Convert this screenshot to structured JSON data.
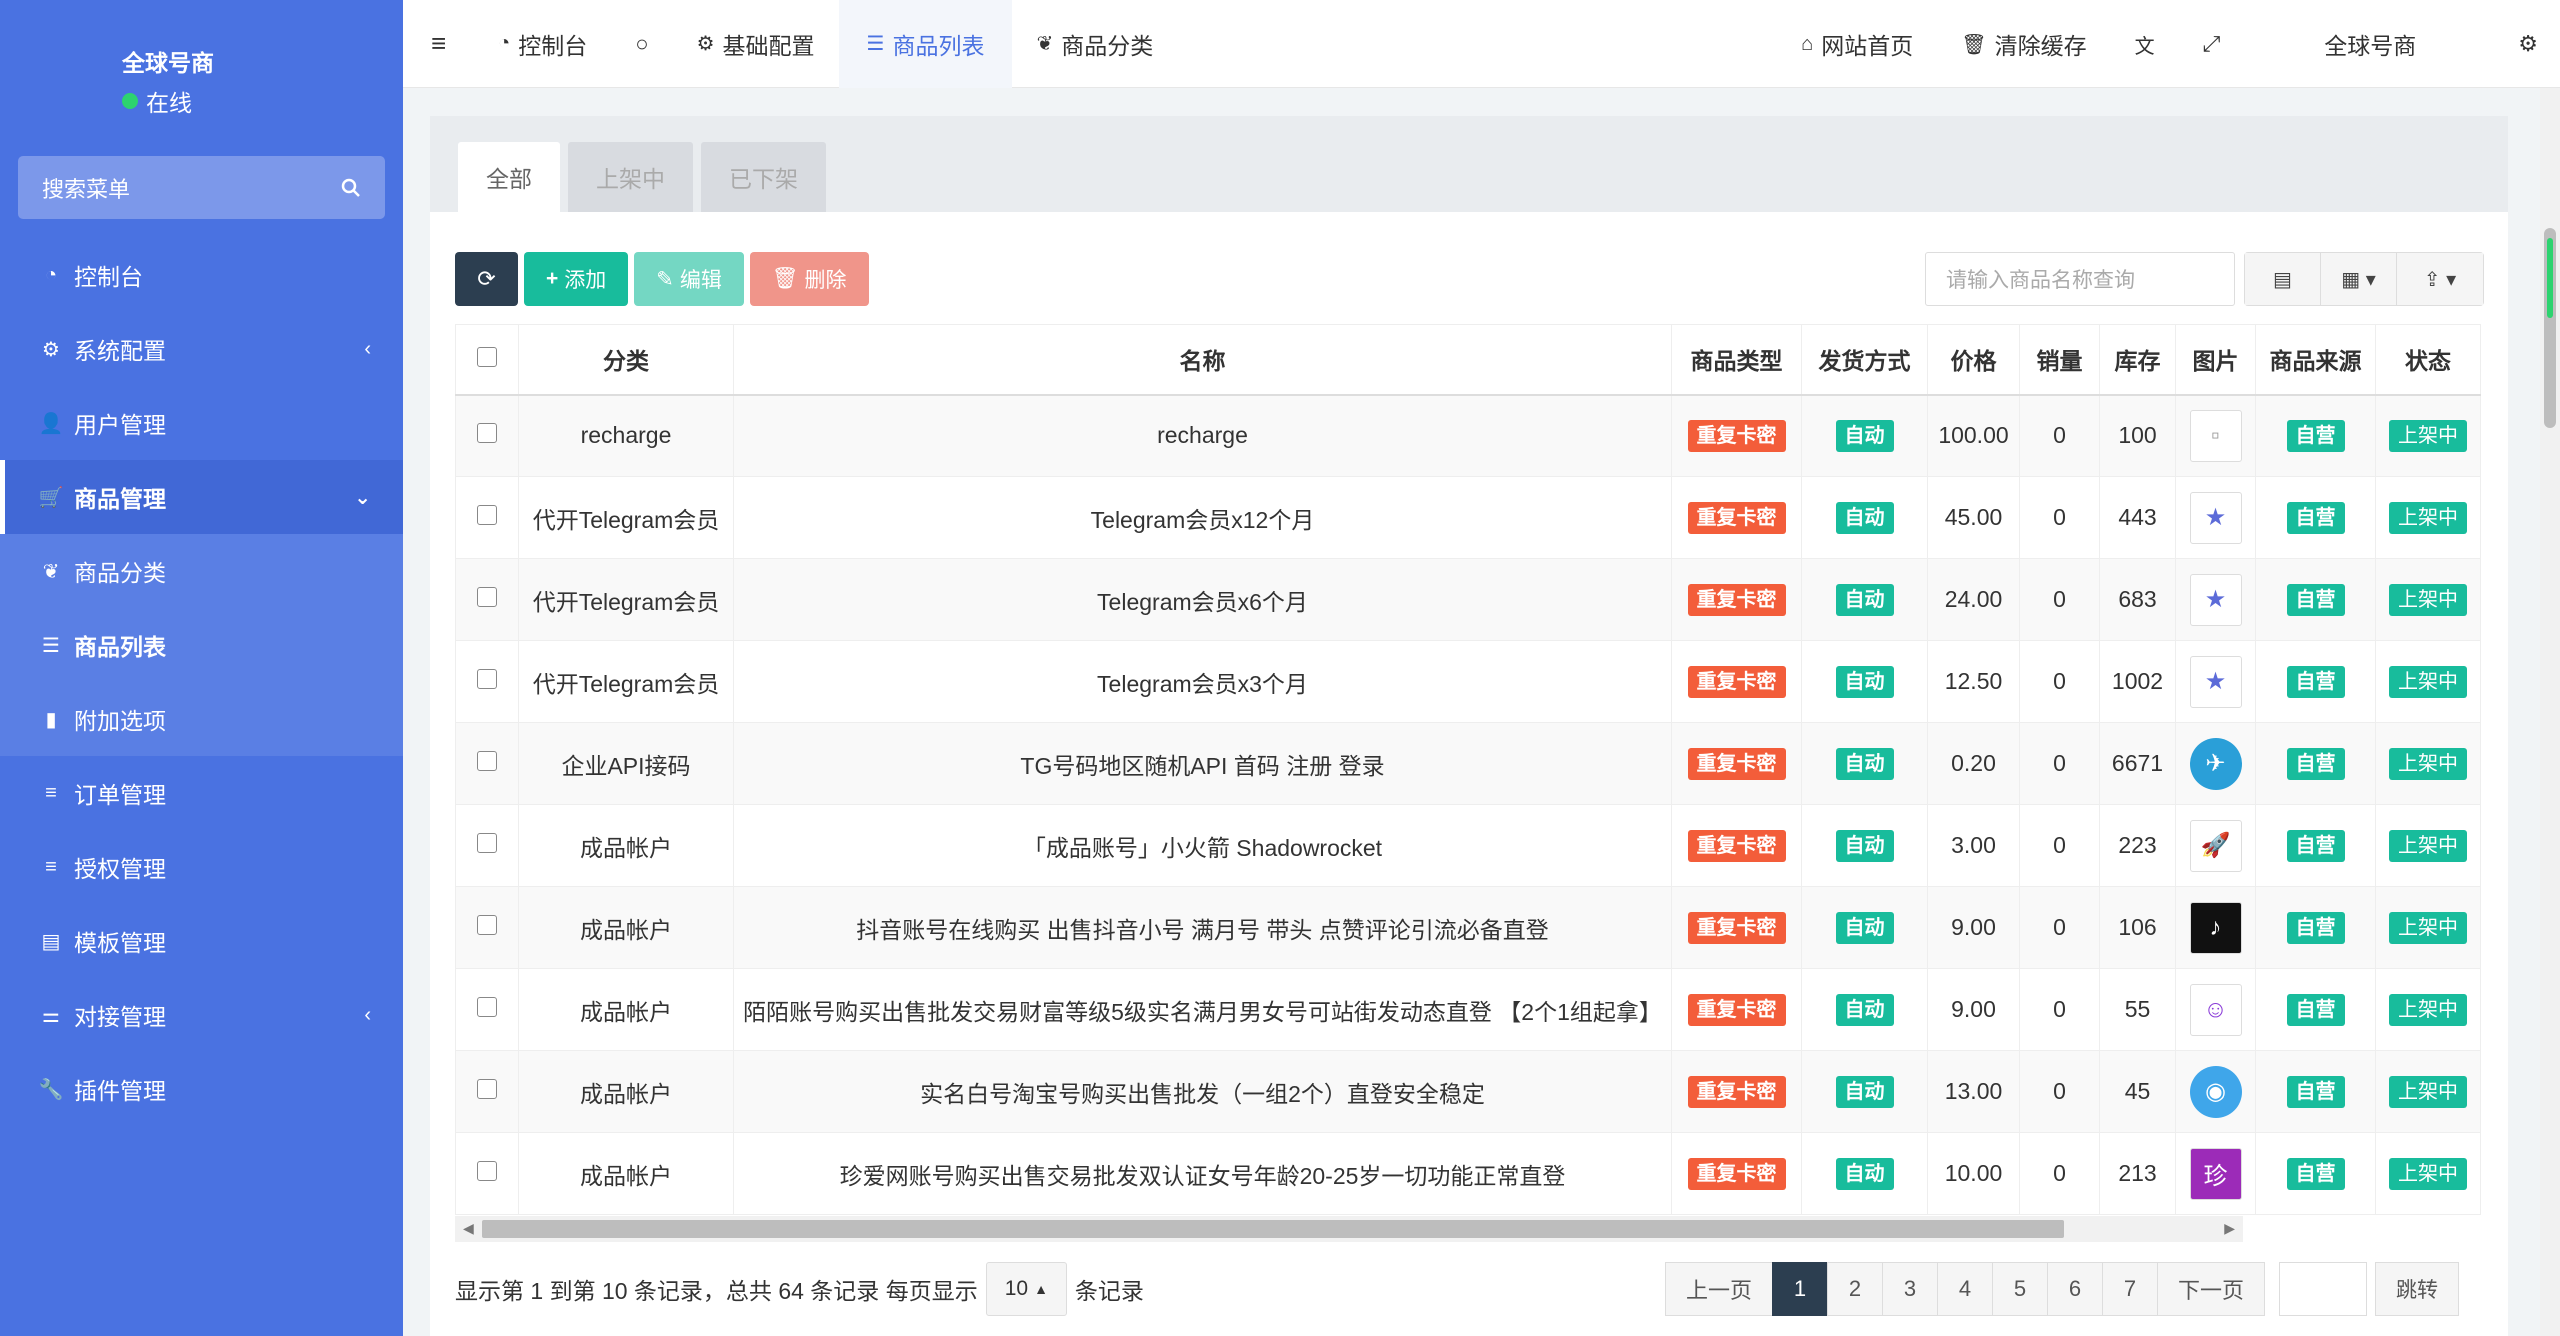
{
  "sidebar": {
    "brand": "全球号商",
    "status": "在线",
    "search_placeholder": "搜索菜单",
    "items": [
      {
        "label": "控制台",
        "icon": "dashboard-icon"
      },
      {
        "label": "系统配置",
        "icon": "gear-icon",
        "chevron": "‹"
      },
      {
        "label": "用户管理",
        "icon": "user-icon"
      },
      {
        "label": "商品管理",
        "icon": "cart-icon",
        "chevron": "⌄"
      },
      {
        "label": "商品分类",
        "icon": "leaf-icon"
      },
      {
        "label": "商品列表",
        "icon": "list-icon"
      },
      {
        "label": "附加选项",
        "icon": "bookmark-icon"
      },
      {
        "label": "订单管理",
        "icon": "bars-icon"
      },
      {
        "label": "授权管理",
        "icon": "bars-icon"
      },
      {
        "label": "模板管理",
        "icon": "template-icon"
      },
      {
        "label": "对接管理",
        "icon": "sliders-icon",
        "chevron": "‹"
      },
      {
        "label": "插件管理",
        "icon": "wrench-icon"
      }
    ]
  },
  "topbar": {
    "tabs": [
      {
        "label": "控制台"
      },
      {
        "label": ""
      },
      {
        "label": "基础配置"
      },
      {
        "label": "商品列表"
      },
      {
        "label": "商品分类"
      }
    ],
    "right": {
      "home": "网站首页",
      "clear_cache": "清除缓存",
      "user": "全球号商"
    }
  },
  "content": {
    "tabs": [
      "全部",
      "上架中",
      "已下架"
    ],
    "toolbar": {
      "add": "添加",
      "edit": "编辑",
      "delete": "删除"
    },
    "search_placeholder": "请输入商品名称查询",
    "columns": [
      "分类",
      "名称",
      "商品类型",
      "发货方式",
      "价格",
      "销量",
      "库存",
      "图片",
      "商品来源",
      "状态"
    ],
    "rows": [
      {
        "category": "recharge",
        "name": "recharge",
        "type": "重复卡密",
        "delivery": "自动",
        "price": "100.00",
        "sales": "0",
        "stock": "100",
        "image": "broken-image-icon",
        "source": "自营",
        "status": "上架中"
      },
      {
        "category": "代开Telegram会员",
        "name": "Telegram会员x12个月",
        "type": "重复卡密",
        "delivery": "自动",
        "price": "45.00",
        "sales": "0",
        "stock": "443",
        "image": "star-icon",
        "source": "自营",
        "status": "上架中"
      },
      {
        "category": "代开Telegram会员",
        "name": "Telegram会员x6个月",
        "type": "重复卡密",
        "delivery": "自动",
        "price": "24.00",
        "sales": "0",
        "stock": "683",
        "image": "star-icon",
        "source": "自营",
        "status": "上架中"
      },
      {
        "category": "代开Telegram会员",
        "name": "Telegram会员x3个月",
        "type": "重复卡密",
        "delivery": "自动",
        "price": "12.50",
        "sales": "0",
        "stock": "1002",
        "image": "star-icon",
        "source": "自营",
        "status": "上架中"
      },
      {
        "category": "企业API接码",
        "name": "TG号码地区随机API 首码 注册 登录",
        "type": "重复卡密",
        "delivery": "自动",
        "price": "0.20",
        "sales": "0",
        "stock": "6671",
        "image": "telegram-icon",
        "source": "自营",
        "status": "上架中"
      },
      {
        "category": "成品帐户",
        "name": "「成品账号」小火箭 Shadowrocket",
        "type": "重复卡密",
        "delivery": "自动",
        "price": "3.00",
        "sales": "0",
        "stock": "223",
        "image": "rocket-icon",
        "source": "自营",
        "status": "上架中"
      },
      {
        "category": "成品帐户",
        "name": "抖音账号在线购买 出售抖音小号 满月号 带头 点赞评论引流必备直登",
        "type": "重复卡密",
        "delivery": "自动",
        "price": "9.00",
        "sales": "0",
        "stock": "106",
        "image": "tiktok-icon",
        "source": "自营",
        "status": "上架中"
      },
      {
        "category": "成品帐户",
        "name": "陌陌账号购买出售批发交易财富等级5级实名满月男女号可站街发动态直登 【2个1组起拿】",
        "type": "重复卡密",
        "delivery": "自动",
        "price": "9.00",
        "sales": "0",
        "stock": "55",
        "image": "momo-icon",
        "source": "自营",
        "status": "上架中"
      },
      {
        "category": "成品帐户",
        "name": "实名白号淘宝号购买出售批发（一组2个）直登安全稳定",
        "type": "重复卡密",
        "delivery": "自动",
        "price": "13.00",
        "sales": "0",
        "stock": "45",
        "image": "taobao-icon",
        "source": "自营",
        "status": "上架中"
      },
      {
        "category": "成品帐户",
        "name": "珍爱网账号购买出售交易批发双认证女号年龄20-25岁一切功能正常直登",
        "type": "重复卡密",
        "delivery": "自动",
        "price": "10.00",
        "sales": "0",
        "stock": "213",
        "image": "zhenai-icon",
        "source": "自营",
        "status": "上架中"
      }
    ],
    "footer": {
      "info_prefix": "显示第 1 到第 10 条记录，总共 64 条记录 每页显示",
      "page_size": "10",
      "info_suffix": "条记录",
      "prev": "上一页",
      "pages": [
        "1",
        "2",
        "3",
        "4",
        "5",
        "6",
        "7"
      ],
      "active_page": "1",
      "next": "下一页",
      "jump": "跳转"
    }
  },
  "colors": {
    "sidebar": "#4a72e1",
    "accent": "#18bc9c",
    "danger": "#f35d3a",
    "dark": "#2c3e50"
  }
}
